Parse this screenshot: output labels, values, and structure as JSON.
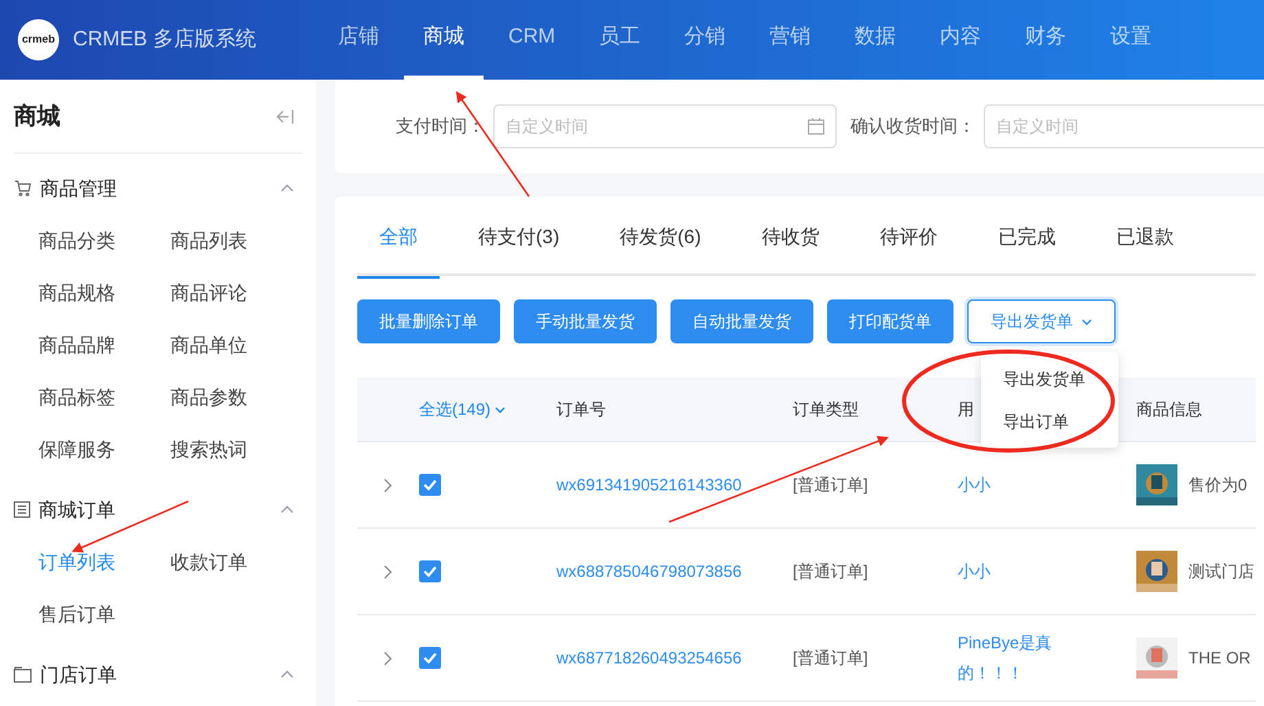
{
  "header": {
    "logo_text": "crmeb",
    "brand": "CRMEB 多店版系统",
    "nav": [
      {
        "label": "店铺",
        "selected": false
      },
      {
        "label": "商城",
        "selected": true
      },
      {
        "label": "CRM",
        "selected": false
      },
      {
        "label": "员工",
        "selected": false
      },
      {
        "label": "分销",
        "selected": false
      },
      {
        "label": "营销",
        "selected": false
      },
      {
        "label": "数据",
        "selected": false
      },
      {
        "label": "内容",
        "selected": false
      },
      {
        "label": "财务",
        "selected": false
      },
      {
        "label": "设置",
        "selected": false
      }
    ]
  },
  "sidebar": {
    "title": "商城",
    "sections": [
      {
        "title": "商品管理",
        "expanded": true,
        "items": [
          {
            "label": "商品分类",
            "selected": false
          },
          {
            "label": "商品列表",
            "selected": false
          },
          {
            "label": "商品规格",
            "selected": false
          },
          {
            "label": "商品评论",
            "selected": false
          },
          {
            "label": "商品品牌",
            "selected": false
          },
          {
            "label": "商品单位",
            "selected": false
          },
          {
            "label": "商品标签",
            "selected": false
          },
          {
            "label": "商品参数",
            "selected": false
          },
          {
            "label": "保障服务",
            "selected": false
          },
          {
            "label": "搜索热词",
            "selected": false
          }
        ]
      },
      {
        "title": "商城订单",
        "expanded": true,
        "items": [
          {
            "label": "订单列表",
            "selected": true
          },
          {
            "label": "收款订单",
            "selected": false
          },
          {
            "label": "售后订单",
            "selected": false
          }
        ]
      },
      {
        "title": "门店订单",
        "expanded": true
      }
    ]
  },
  "filters": [
    {
      "label": "支付时间：",
      "placeholder": "自定义时间"
    },
    {
      "label": "确认收货时间：",
      "placeholder": "自定义时间"
    }
  ],
  "tabs": [
    {
      "label": "全部",
      "selected": true
    },
    {
      "label": "待支付(3)",
      "selected": false
    },
    {
      "label": "待发货(6)",
      "selected": false
    },
    {
      "label": "待收货",
      "selected": false
    },
    {
      "label": "待评价",
      "selected": false
    },
    {
      "label": "已完成",
      "selected": false
    },
    {
      "label": "已退款",
      "selected": false
    }
  ],
  "buttons": [
    {
      "label": "批量删除订单",
      "kind": "primary"
    },
    {
      "label": "手动批量发货",
      "kind": "primary"
    },
    {
      "label": "自动批量发货",
      "kind": "primary"
    },
    {
      "label": "打印配货单",
      "kind": "primary"
    },
    {
      "label": "导出发货单",
      "kind": "dropdown"
    }
  ],
  "dropdown_menu": [
    {
      "label": "导出发货单"
    },
    {
      "label": "导出订单"
    }
  ],
  "table": {
    "select_all": "全选(149)",
    "columns": [
      "订单号",
      "订单类型",
      "用",
      "商品信息"
    ],
    "rows": [
      {
        "expanded": false,
        "checked": true,
        "order_no": "wx691341905216143360",
        "type": "[普通订单]",
        "user": "小小",
        "product": "售价为0",
        "kind": "picture"
      },
      {
        "expanded": false,
        "checked": true,
        "order_no": "wx688785046798073856",
        "type": "[普通订单]",
        "user": "小小",
        "product": "测试门店",
        "kind": "picture"
      },
      {
        "expanded": false,
        "checked": true,
        "order_no": "wx687718260493254656",
        "type": "[普通订单]",
        "user": "PineBye是真的！！！",
        "product": "THE OR",
        "kind": "picture"
      }
    ]
  }
}
